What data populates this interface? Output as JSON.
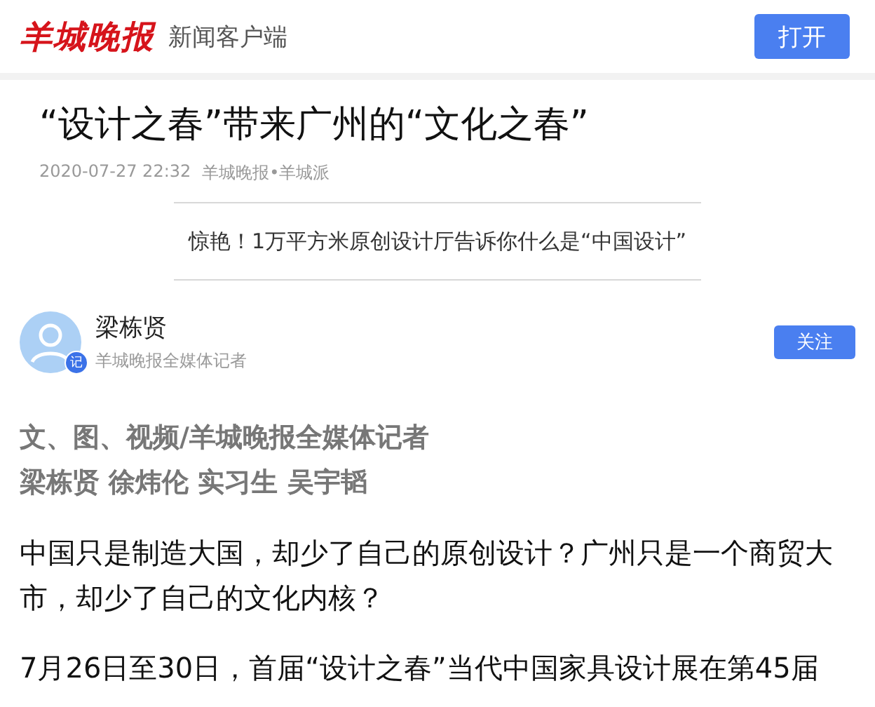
{
  "header": {
    "logo": "羊城晚报",
    "subtitle": "新闻客户端",
    "open_button": "打开"
  },
  "article": {
    "title": "“设计之春”带来广州的“文化之春”",
    "date": "2020-07-27 22:32",
    "source": "羊城晚报•羊城派",
    "related_link": "惊艳！1万平方米原创设计厅告诉你什么是“中国设计”",
    "author": {
      "name": "梁栋贤",
      "role": "羊城晚报全媒体记者",
      "badge": "记",
      "follow_button": "关注"
    },
    "byline": [
      "文、图、视频/羊城晚报全媒体记者",
      "梁栋贤 徐炜伦 实习生 吴宇韬"
    ],
    "paragraphs": [
      "中国只是制造大国，却少了自己的原创设计？广州只是一个商贸大市，却少了自己的文化内核？",
      "7月26日至30日，首届“设计之春”当代中国家具设计展在第45届"
    ]
  }
}
